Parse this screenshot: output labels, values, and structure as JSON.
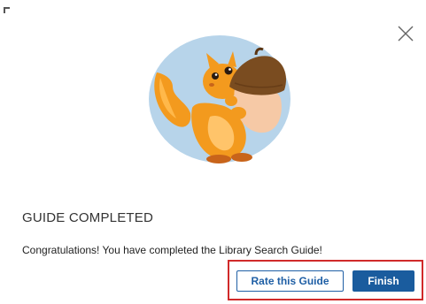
{
  "dialog": {
    "heading": "GUIDE COMPLETED",
    "message": "Congratulations! You have completed the Library Search Guide!",
    "illustration": "squirrel-with-acorn",
    "close_icon": "close-icon"
  },
  "actions": {
    "rate_label": "Rate this Guide",
    "finish_label": "Finish"
  },
  "colors": {
    "primary": "#1a5c9e",
    "highlight": "#d02a2a",
    "illustration_bg": "#b7d4ea",
    "squirrel": "#f39a1e",
    "acorn": "#f6c9a6",
    "acorn_cap": "#7a4c20"
  }
}
